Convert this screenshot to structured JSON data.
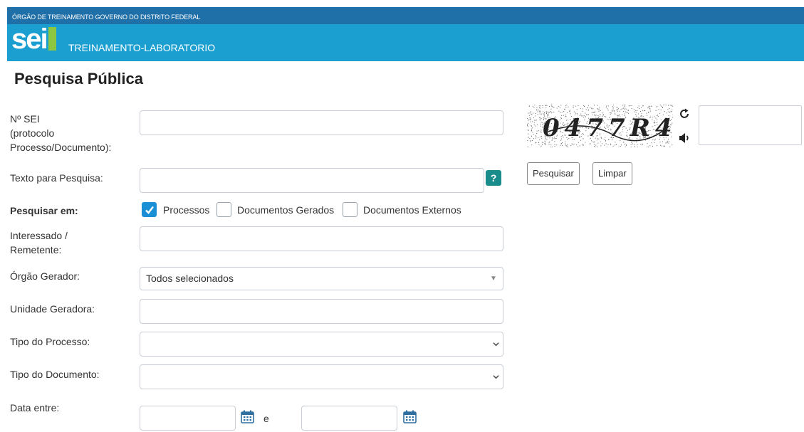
{
  "header": {
    "org_name": "ÓRGÃO DE TREINAMENTO GOVERNO DO DISTRITO FEDERAL",
    "logo_text": "sei",
    "unit_name": "TREINAMENTO-LABORATORIO"
  },
  "page": {
    "title": "Pesquisa Pública"
  },
  "form": {
    "nsei": {
      "label_line1": "Nº SEI",
      "label_line2": "(protocolo",
      "label_line3": "Processo/Documento):",
      "value": ""
    },
    "texto": {
      "label": "Texto para Pesquisa:",
      "value": "",
      "help": "?"
    },
    "pesquisar_em": {
      "label": "Pesquisar em:",
      "options": [
        {
          "label": "Processos",
          "checked": true
        },
        {
          "label": "Documentos Gerados",
          "checked": false
        },
        {
          "label": "Documentos Externos",
          "checked": false
        }
      ]
    },
    "interessado": {
      "label_line1": "Interessado /",
      "label_line2": "Remetente:",
      "value": ""
    },
    "orgao_gerador": {
      "label": "Órgão Gerador:",
      "selected": "Todos selecionados"
    },
    "unidade_geradora": {
      "label": "Unidade Geradora:",
      "value": ""
    },
    "tipo_processo": {
      "label": "Tipo do Processo:",
      "selected": ""
    },
    "tipo_documento": {
      "label": "Tipo do Documento:",
      "selected": ""
    },
    "data": {
      "label": "Data entre:",
      "conjunction": "e",
      "from": "",
      "to": ""
    }
  },
  "captcha": {
    "code": "0477R4",
    "refresh_icon": "refresh-icon",
    "audio_icon": "speaker-icon",
    "value": ""
  },
  "actions": {
    "search_label": "Pesquisar",
    "clear_label": "Limpar"
  },
  "colors": {
    "topbar": "#1f6fa8",
    "brand": "#1b9fd1",
    "checkbox_checked": "#1a8fd6",
    "help": "#1a8c8c"
  }
}
